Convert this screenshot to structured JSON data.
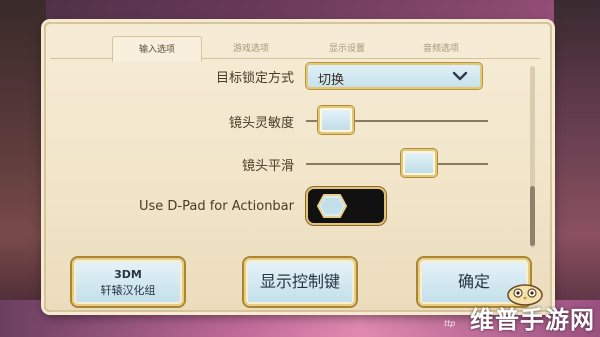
{
  "tabs": [
    {
      "label": "输入选项",
      "active": true
    },
    {
      "label": "游戏选项",
      "active": false
    },
    {
      "label": "显示设置",
      "active": false
    },
    {
      "label": "音频选项",
      "active": false
    }
  ],
  "settings": {
    "target_lock": {
      "label": "目标锁定方式",
      "value": "切换",
      "icon": "chevron-down-icon"
    },
    "camera_sensitivity": {
      "label": "镜头灵敏度",
      "level": 0.08
    },
    "camera_smoothing": {
      "label": "镜头平滑",
      "level": 0.65
    },
    "dpad_actionbar": {
      "label": "Use D-Pad for Actionbar",
      "enabled": false
    }
  },
  "buttons": {
    "credit_line1": "3DM",
    "credit_line2": "轩辕汉化组",
    "show_controls": "显示控制键",
    "confirm": "确定"
  },
  "watermark": {
    "text": "维普手游网",
    "url": "ttp"
  },
  "colors": {
    "parchment": "#f1e4c8",
    "gold_border": "#e2c878",
    "button_fill": "#c8e2ec",
    "text_dark": "#4a3a2a"
  }
}
